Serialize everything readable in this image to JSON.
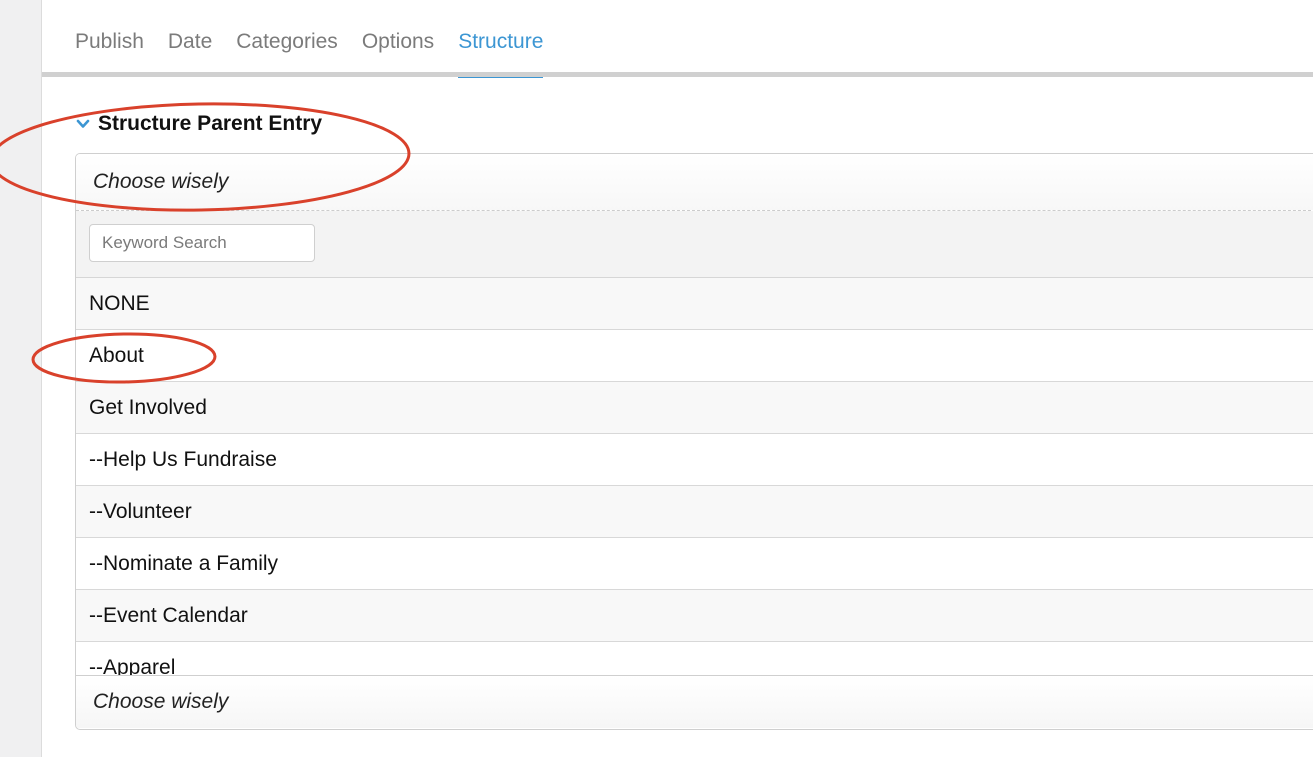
{
  "tabs": [
    {
      "label": "Publish"
    },
    {
      "label": "Date"
    },
    {
      "label": "Categories"
    },
    {
      "label": "Options"
    },
    {
      "label": "Structure",
      "active": true
    }
  ],
  "section": {
    "title": "Structure Parent Entry",
    "icon": "chevron-down-icon"
  },
  "field": {
    "selected_text": "Choose wisely",
    "search_placeholder": "Keyword Search",
    "options": [
      "NONE",
      "About",
      "Get Involved",
      "--Help Us Fundraise",
      "--Volunteer",
      "--Nominate a Family",
      "--Event Calendar",
      "--Apparel"
    ],
    "footer_text": "Choose wisely"
  },
  "colors": {
    "accent": "#3c96d3",
    "annotation": "#d9412b"
  }
}
